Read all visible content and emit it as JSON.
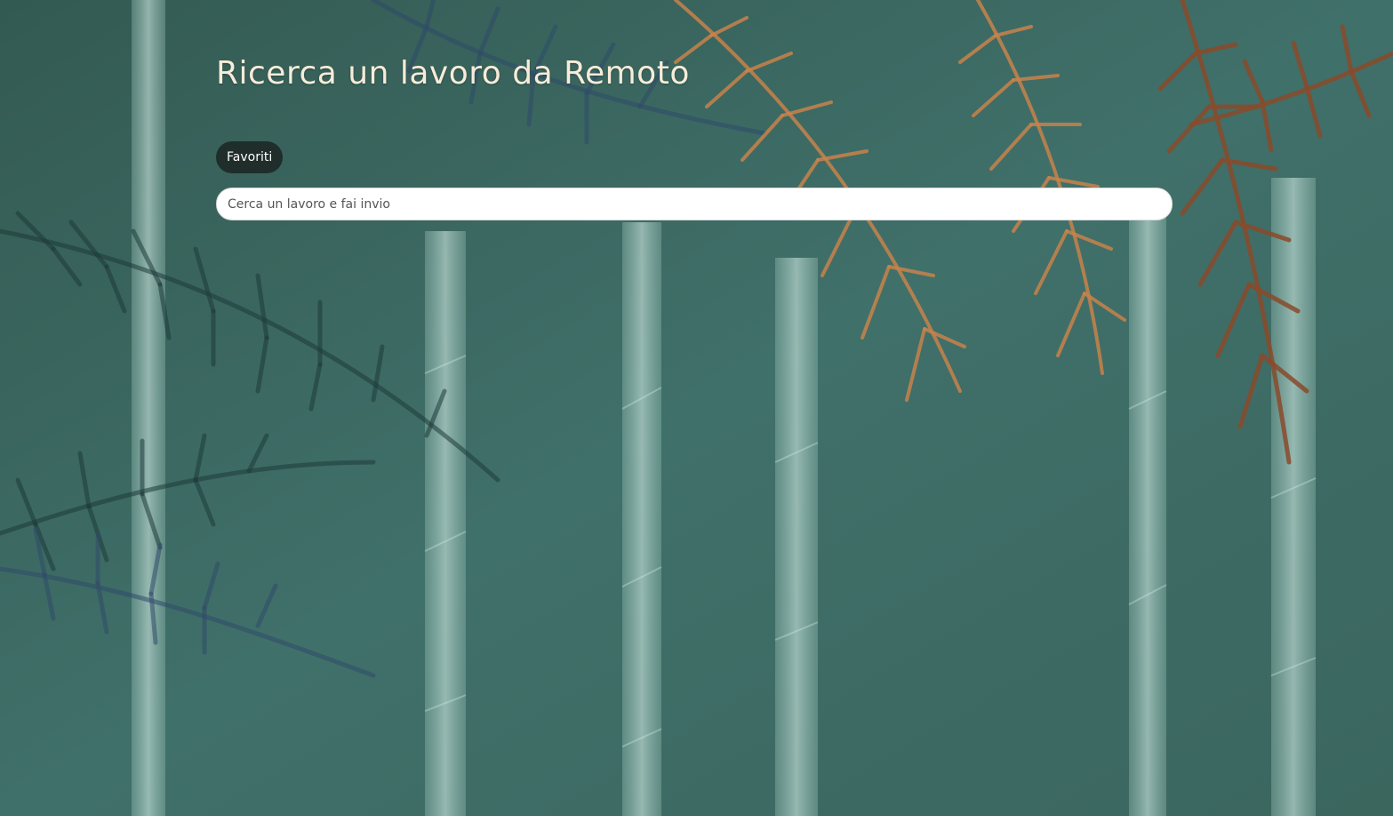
{
  "page": {
    "title": "Ricerca un lavoro da Remoto"
  },
  "favorites": {
    "label": "Favoriti"
  },
  "search": {
    "placeholder": "Cerca un lavoro e fai invio",
    "value": ""
  },
  "background": {
    "description_icon": "tropical-palm-wallpaper",
    "colors": {
      "base": "#3f6c62",
      "trunk": "#a9cfc6",
      "frond_dark": "#1e3a3a",
      "frond_blue": "#2f4a6a",
      "frond_copper": "#c8824a",
      "frond_rust": "#8a4a2a"
    }
  }
}
